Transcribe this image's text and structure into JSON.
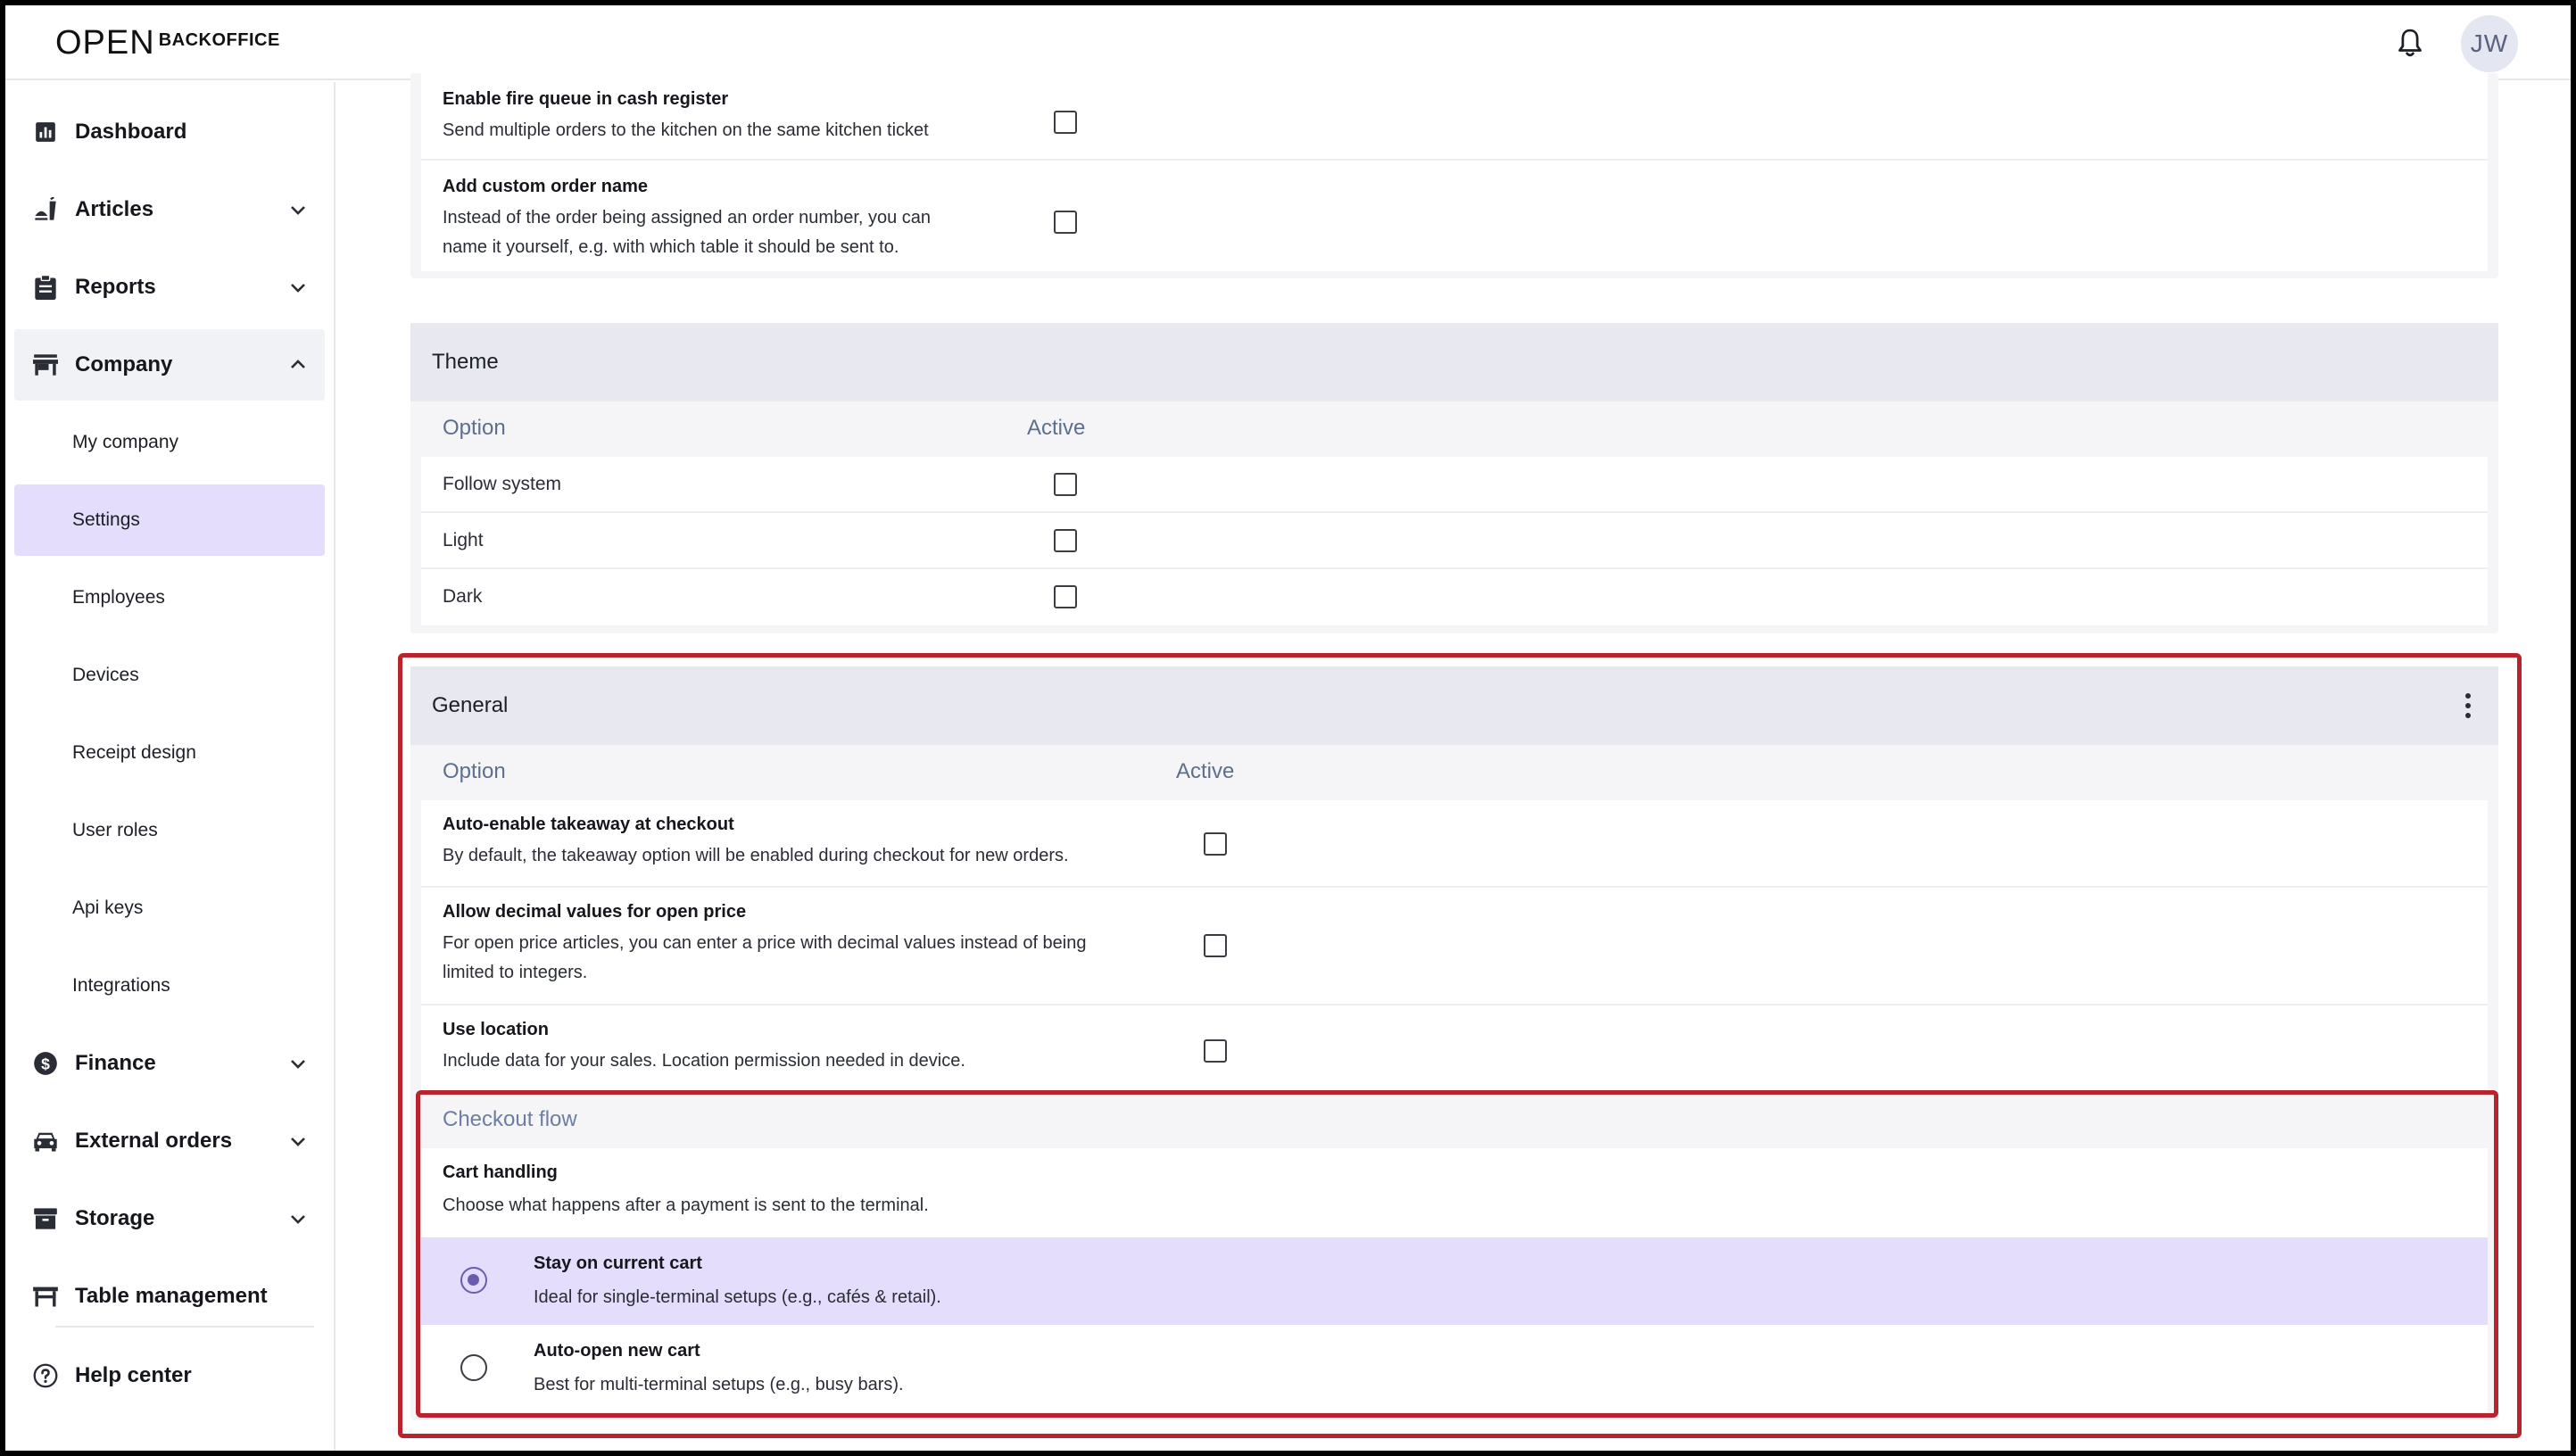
{
  "header": {
    "logo_mark": "OPEN",
    "logo_text": "BACKOFFICE",
    "avatar_initials": "JW"
  },
  "sidebar": {
    "items": [
      {
        "label": "Dashboard",
        "icon": "dashboard-icon"
      },
      {
        "label": "Articles",
        "icon": "articles-icon"
      },
      {
        "label": "Reports",
        "icon": "reports-icon"
      },
      {
        "label": "Company",
        "icon": "store-icon"
      },
      {
        "label": "Finance",
        "icon": "finance-icon"
      },
      {
        "label": "External orders",
        "icon": "car-icon"
      },
      {
        "label": "Storage",
        "icon": "storage-icon"
      },
      {
        "label": "Table management",
        "icon": "table-icon"
      },
      {
        "label": "Help center",
        "icon": "help-icon"
      }
    ],
    "company_sub": [
      "My company",
      "Settings",
      "Employees",
      "Devices",
      "Receipt design",
      "User roles",
      "Api keys",
      "Integrations"
    ],
    "active_sub": "Settings"
  },
  "top_card": {
    "rows": [
      {
        "title": "Enable fire queue in cash register",
        "desc": "Send multiple orders to the kitchen on the same kitchen ticket",
        "active": false
      },
      {
        "title": "Add custom order name",
        "desc_lines": [
          "Instead of the order being assigned an order number, you can",
          "name it yourself, e.g. with which table it should be sent to."
        ],
        "active": false
      }
    ]
  },
  "theme": {
    "title": "Theme",
    "col_option": "Option",
    "col_active": "Active",
    "rows": [
      {
        "label": "Follow system",
        "active": false
      },
      {
        "label": "Light",
        "active": false
      },
      {
        "label": "Dark",
        "active": false
      }
    ]
  },
  "general": {
    "title": "General",
    "col_option": "Option",
    "col_active": "Active",
    "rows": [
      {
        "title": "Auto-enable takeaway at checkout",
        "desc_lines": [
          "By default, the takeaway option will be enabled during checkout for new orders."
        ],
        "active": false
      },
      {
        "title": "Allow decimal values for open price",
        "desc_lines": [
          "For open price articles, you can enter a price with decimal values instead of being",
          "limited to integers."
        ],
        "active": false
      },
      {
        "title": "Use location",
        "desc_lines": [
          "Include data for your sales. Location permission needed in device."
        ],
        "active": false
      }
    ],
    "checkout_flow": {
      "section_label": "Checkout flow",
      "title": "Cart handling",
      "desc": "Choose what happens after a payment is sent to the terminal.",
      "options": [
        {
          "title": "Stay on current cart",
          "desc": "Ideal for single-terminal setups (e.g., cafés & retail).",
          "selected": true
        },
        {
          "title": "Auto-open new cart",
          "desc": "Best for multi-terminal setups (e.g., busy bars).",
          "selected": false
        }
      ]
    }
  },
  "colors": {
    "accent": "#6d5bb0",
    "selected_bg": "#e4ddfc",
    "highlight": "#b8232d"
  }
}
